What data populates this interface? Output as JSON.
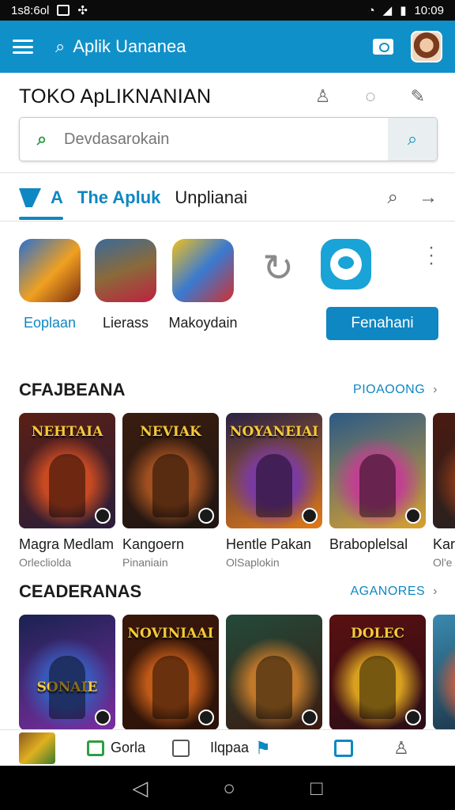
{
  "status_bar": {
    "time_left": "1s8:6ol",
    "time_right": "10:09"
  },
  "app_bar": {
    "search_label": "Aplik Uananea"
  },
  "store": {
    "title": "TOKO ApLIKNANIAN"
  },
  "search": {
    "placeholder": "Devdasarokain"
  },
  "tabs": [
    {
      "label": "A",
      "active": true
    },
    {
      "label": "The Apluk",
      "active": true
    },
    {
      "label": "Unplianai",
      "active": false
    }
  ],
  "quick_apps": [
    {
      "label": "Eoplaan",
      "icon": "game-icon-monkey",
      "highlight": true
    },
    {
      "label": "Lierass",
      "icon": "game-icon-soldier",
      "highlight": false
    },
    {
      "label": "Makoydain",
      "icon": "game-icon-hero",
      "highlight": false
    }
  ],
  "primary_button": "Fenahani",
  "sections": [
    {
      "title": "CFAJBEANA",
      "link": "PIOAOONG",
      "cards": [
        {
          "name": "Magra Medlam",
          "sub": "Orlecliolda",
          "art_title": "NEHTAIA",
          "colors": [
            "#5a1f14",
            "#c84a22",
            "#2a1e3a"
          ]
        },
        {
          "name": "Kangoern",
          "sub": "Pinaniain",
          "art_title": "NEVIAK",
          "colors": [
            "#3a1d10",
            "#a05020",
            "#1e1512"
          ]
        },
        {
          "name": "Hentle Pakan",
          "sub": "OlSaplokin",
          "art_title": "NOYANEIAI",
          "colors": [
            "#2a2246",
            "#7a3aa0",
            "#e07a18"
          ]
        },
        {
          "name": "Braboplelsal",
          "sub": "",
          "art_title": "",
          "colors": [
            "#2b5a86",
            "#c04090",
            "#d8a030"
          ]
        },
        {
          "name": "Kar",
          "sub": "Ol'e",
          "art_title": "",
          "colors": [
            "#4a1a10",
            "#8a3a18",
            "#222"
          ]
        }
      ]
    },
    {
      "title": "CEADERANAS",
      "link": "AGANORES",
      "cards": [
        {
          "name": "",
          "sub": "",
          "art_title": "SONAIE",
          "colors": [
            "#1a2250",
            "#3a58b8",
            "#7a2ea0"
          ]
        },
        {
          "name": "",
          "sub": "",
          "art_title": "NOVINIAAI",
          "colors": [
            "#3a180c",
            "#c05a18",
            "#2a1208"
          ]
        },
        {
          "name": "",
          "sub": "",
          "art_title": "",
          "colors": [
            "#234a3a",
            "#c0782a",
            "#3a1a10"
          ]
        },
        {
          "name": "",
          "sub": "",
          "art_title": "DOLEC",
          "colors": [
            "#5a1010",
            "#d8a020",
            "#2a0e18"
          ]
        },
        {
          "name": "",
          "sub": "",
          "art_title": "",
          "colors": [
            "#3a8ab0",
            "#d06040",
            "#1a2a3a"
          ]
        }
      ]
    }
  ],
  "bottom_nav": [
    {
      "label": "",
      "icon": "game-thumb-icon"
    },
    {
      "label": "Gorla",
      "icon": "apps-icon"
    },
    {
      "label": "",
      "icon": "tablet-icon"
    },
    {
      "label": "Ilqpaa",
      "icon": "bookmark-icon"
    },
    {
      "label": "",
      "icon": "library-icon"
    },
    {
      "label": "",
      "icon": "profile-icon"
    }
  ]
}
